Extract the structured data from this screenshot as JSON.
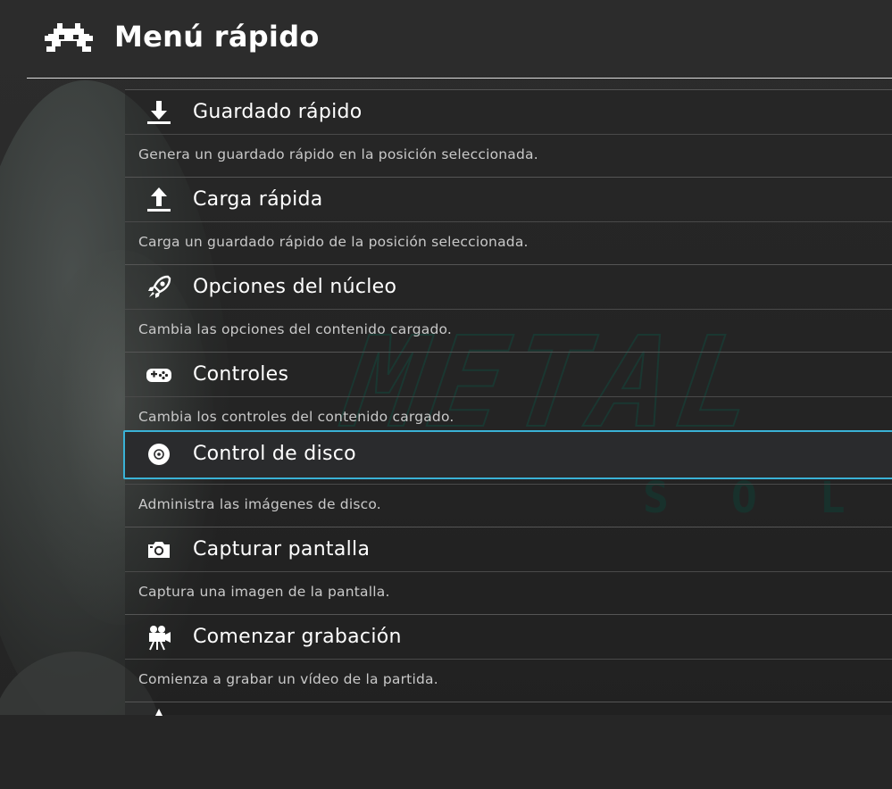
{
  "header": {
    "title": "Menú rápido",
    "logo_icon": "retroarch-invader-icon"
  },
  "menu": {
    "items": [
      {
        "label": "Guardado rápido",
        "description": "Genera un guardado rápido en la posición seleccionada.",
        "icon": "download-icon"
      },
      {
        "label": "Carga rápida",
        "description": "Carga un guardado rápido de la posición seleccionada.",
        "icon": "upload-icon"
      },
      {
        "label": "Opciones del núcleo",
        "description": "Cambia las opciones del contenido cargado.",
        "icon": "rocket-icon"
      },
      {
        "label": "Controles",
        "description": "Cambia los controles del contenido cargado.",
        "icon": "gamepad-icon"
      },
      {
        "label": "Control de disco",
        "description": "Administra las imágenes de disco.",
        "icon": "disc-icon",
        "selected": true
      },
      {
        "label": "Capturar pantalla",
        "description": "Captura una imagen de la pantalla.",
        "icon": "camera-icon"
      },
      {
        "label": "Comenzar grabación",
        "description": "Comienza a grabar un vídeo de la partida.",
        "icon": "movie-camera-icon"
      }
    ]
  },
  "colors": {
    "selection_border": "#3ab2d6",
    "text_primary": "#ffffff",
    "text_secondary": "#c9c9c9"
  }
}
